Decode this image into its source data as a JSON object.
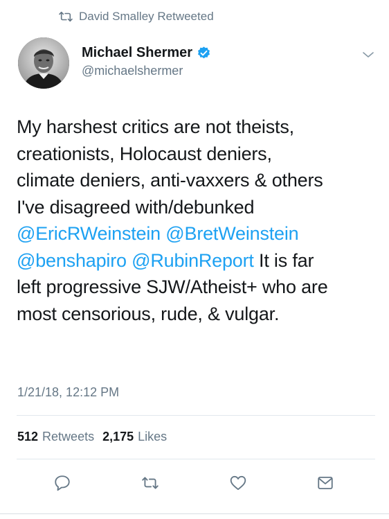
{
  "retweet_banner": {
    "text": "David Smalley Retweeted"
  },
  "author": {
    "name": "Michael Shermer",
    "handle": "@michaelshermer",
    "verified": true
  },
  "tweet": {
    "lines": [
      [
        {
          "t": "My harshest critics are not theists,",
          "m": false
        }
      ],
      [
        {
          "t": "creationists, Holocaust deniers,",
          "m": false
        }
      ],
      [
        {
          "t": "climate deniers, anti-vaxxers & others",
          "m": false
        }
      ],
      [
        {
          "t": "I've disagreed with/debunked",
          "m": false
        }
      ],
      [
        {
          "t": "@EricRWeinstein",
          "m": true
        },
        {
          "t": " ",
          "m": false
        },
        {
          "t": "@BretWeinstein",
          "m": true
        }
      ],
      [
        {
          "t": "@benshapiro",
          "m": true
        },
        {
          "t": " ",
          "m": false
        },
        {
          "t": "@RubinReport",
          "m": true
        },
        {
          "t": " It is far",
          "m": false
        }
      ],
      [
        {
          "t": "left progressive SJW/Atheist+ who are",
          "m": false
        }
      ],
      [
        {
          "t": "most censorious, rude, & vulgar.",
          "m": false
        }
      ]
    ],
    "timestamp": "1/21/18, 12:12 PM"
  },
  "stats": {
    "retweets": {
      "count": "512",
      "label": "Retweets"
    },
    "likes": {
      "count": "2,175",
      "label": "Likes"
    }
  },
  "colors": {
    "link": "#1da1f2",
    "secondary": "#657786",
    "verified": "#1da1f2"
  },
  "icons": [
    "retweet-icon",
    "verified-badge-icon",
    "chevron-down-icon",
    "reply-icon",
    "retweet-icon",
    "like-icon",
    "direct-message-icon"
  ]
}
